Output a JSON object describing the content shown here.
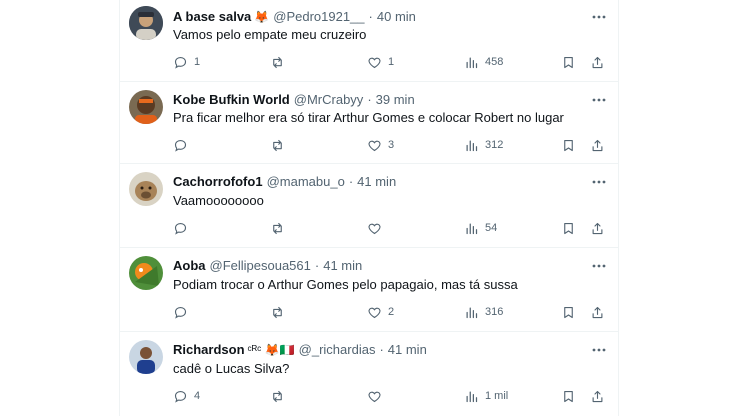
{
  "tweets": [
    {
      "name": "A base salva",
      "badge": "🦊",
      "handle": "@Pedro1921__",
      "time": "40 min",
      "text": "Vamos pelo empate meu cruzeiro",
      "replies": "1",
      "likes": "1",
      "views": "458"
    },
    {
      "name": "Kobe Bufkin World",
      "badge": "",
      "handle": "@MrCrabyy",
      "time": "39 min",
      "text": "Pra ficar melhor era só tirar Arthur Gomes e colocar Robert no lugar",
      "replies": "",
      "likes": "3",
      "views": "312"
    },
    {
      "name": "Cachorrofofo1",
      "badge": "",
      "handle": "@mamabu_o",
      "time": "41 min",
      "text": "Vaamoooooooo",
      "replies": "",
      "likes": "",
      "views": "54"
    },
    {
      "name": "Aoba",
      "badge": "",
      "handle": "@Fellipesoua561",
      "time": "41 min",
      "text": "Podiam trocar o Arthur Gomes pelo papagaio, mas tá sussa",
      "replies": "",
      "likes": "2",
      "views": "316"
    },
    {
      "name": "Richardson",
      "badge": "ᶜᴿᶜ 🦊🇮🇹",
      "handle": "@_richardias",
      "time": "41 min",
      "text": "cadê o Lucas Silva?",
      "replies": "4",
      "likes": "",
      "views": "1 mil"
    }
  ],
  "separator": "·",
  "icons": [
    "more-icon",
    "reply-icon",
    "retweet-icon",
    "like-icon",
    "views-icon",
    "bookmark-icon",
    "share-icon"
  ],
  "colors": {
    "text": "#0f1419",
    "secondary": "#536471",
    "divider": "#eff3f4"
  }
}
